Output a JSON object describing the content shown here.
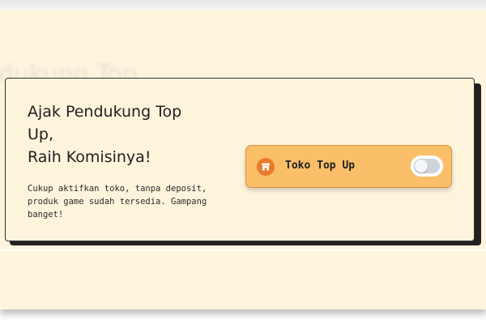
{
  "background": {
    "ghost_heading": "dukung Top"
  },
  "card": {
    "title_line1": "Ajak Pendukung Top",
    "title_line2": "Up,",
    "title_line3": "Raih Komisinya!",
    "description": "Cukup aktifkan toko, tanpa deposit, produk game sudah tersedia. Gampang banget!"
  },
  "toggle": {
    "label": "Toko Top Up",
    "icon": "store-icon",
    "enabled": false
  },
  "colors": {
    "page_bg": "#fdf5de",
    "toggle_bg": "#fbbf6a",
    "icon_bg": "#e97b2a",
    "switch_track_off": "#cfd4da"
  }
}
